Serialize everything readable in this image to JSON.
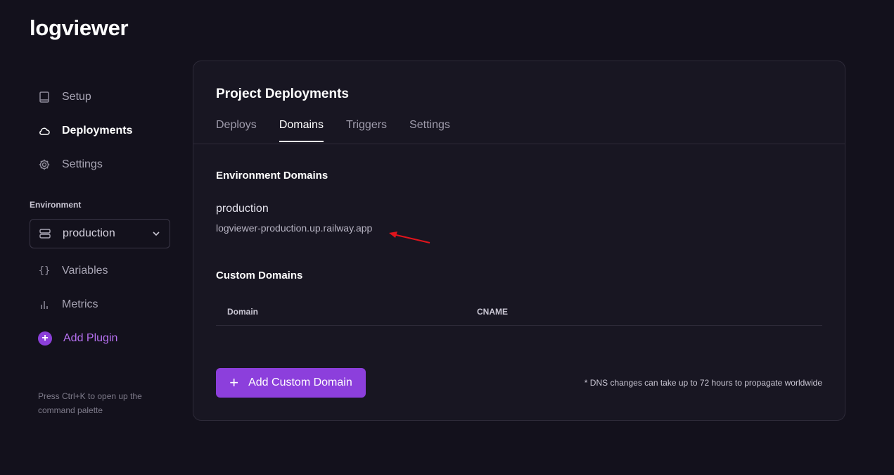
{
  "app": {
    "title": "logviewer"
  },
  "sidebar": {
    "items": [
      {
        "label": "Setup",
        "icon": "book-icon"
      },
      {
        "label": "Deployments",
        "icon": "cloud-icon",
        "active": true
      },
      {
        "label": "Settings",
        "icon": "gear-icon"
      }
    ],
    "environment_label": "Environment",
    "environment_value": "production",
    "secondary_items": [
      {
        "label": "Variables",
        "icon": "braces-icon"
      },
      {
        "label": "Metrics",
        "icon": "bar-chart-icon"
      }
    ],
    "add_plugin_label": "Add Plugin",
    "hint": "Press Ctrl+K to open up the command palette"
  },
  "main": {
    "title": "Project Deployments",
    "tabs": [
      {
        "label": "Deploys"
      },
      {
        "label": "Domains",
        "active": true
      },
      {
        "label": "Triggers"
      },
      {
        "label": "Settings"
      }
    ],
    "env_domains": {
      "title": "Environment Domains",
      "env_name": "production",
      "url": "logviewer-production.up.railway.app"
    },
    "custom_domains": {
      "title": "Custom Domains",
      "columns": [
        "Domain",
        "CNAME"
      ],
      "rows": []
    },
    "add_button_label": "Add Custom Domain",
    "dns_note": "* DNS changes can take up to 72 hours to propagate worldwide"
  },
  "colors": {
    "background": "#13111c",
    "card": "#181622",
    "accent": "#8c3fdc",
    "annotation_arrow": "#e0141c"
  }
}
